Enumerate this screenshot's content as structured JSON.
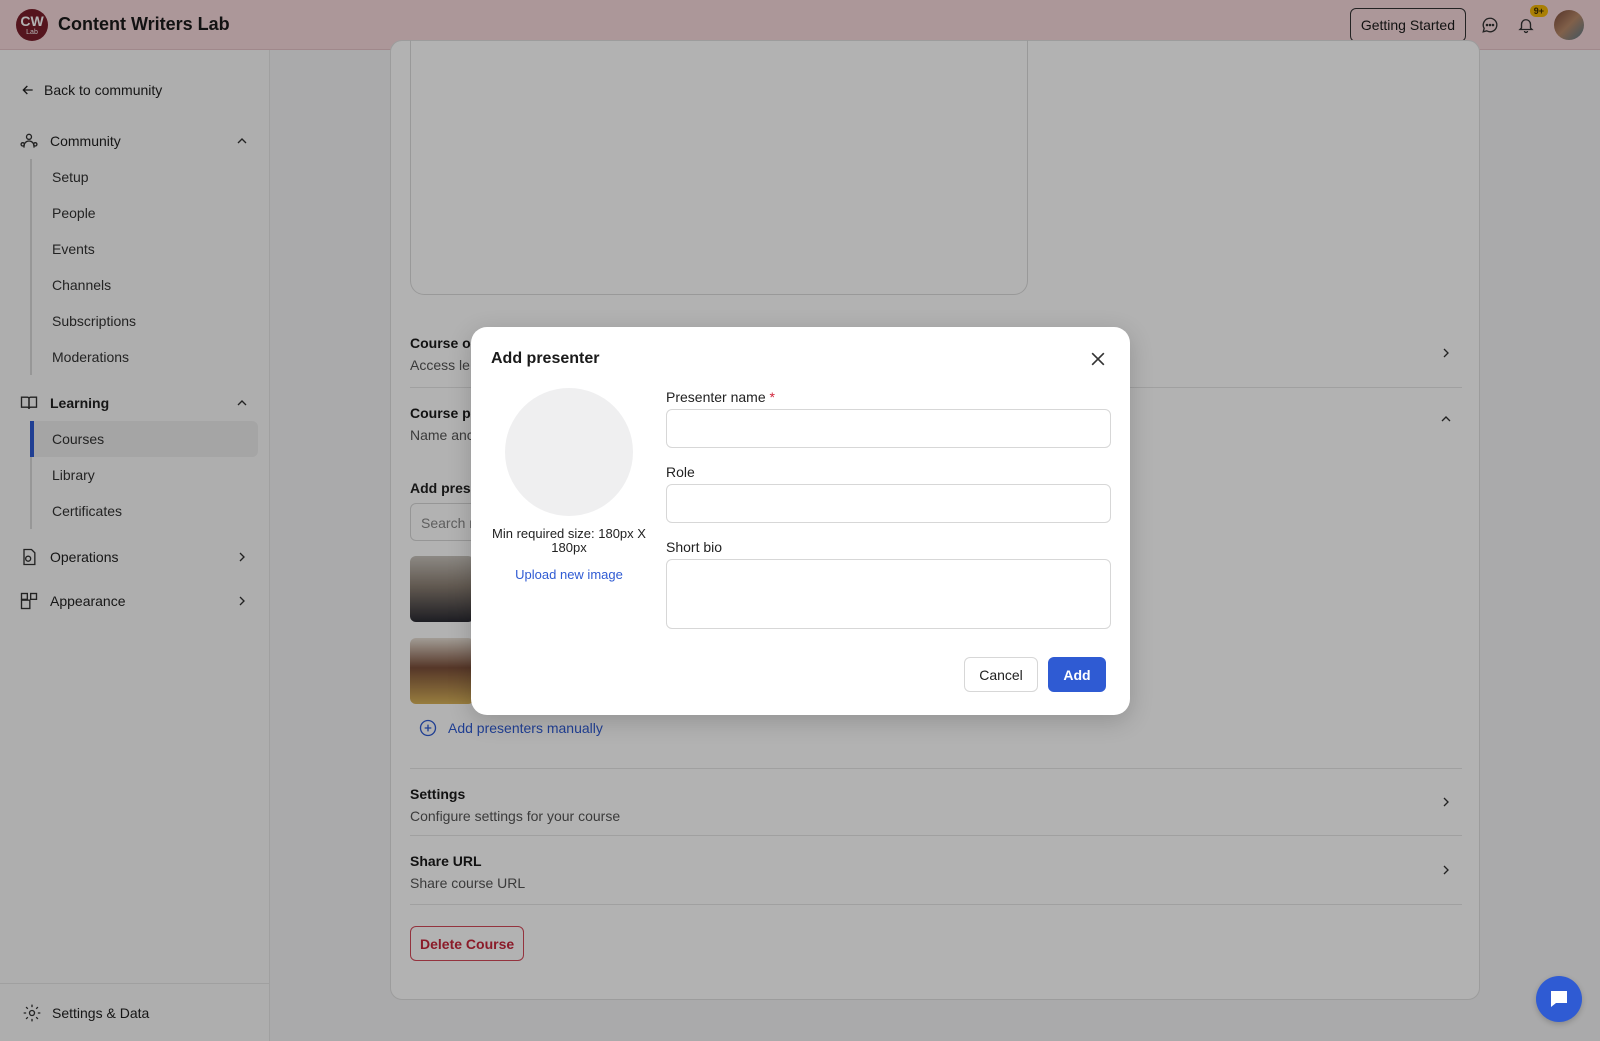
{
  "header": {
    "logo_big": "CW",
    "logo_small": "Lab",
    "title": "Content Writers Lab",
    "getting_started": "Getting Started",
    "notification_badge": "9+",
    "icons": [
      "chat-bubble-icon",
      "bell-icon"
    ]
  },
  "sidebar": {
    "back": "Back to community",
    "community": {
      "label": "Community",
      "items": [
        "Setup",
        "People",
        "Events",
        "Channels",
        "Subscriptions",
        "Moderations"
      ]
    },
    "learning": {
      "label": "Learning",
      "items": [
        "Courses",
        "Library",
        "Certificates"
      ],
      "active": "Courses"
    },
    "operations": "Operations",
    "appearance": "Appearance",
    "settings_data": "Settings & Data"
  },
  "main": {
    "course_options": {
      "title": "Course op",
      "subtitle": "Access le"
    },
    "course_presenters": {
      "title": "Course pr",
      "subtitle": "Name anc"
    },
    "add_presenters_label": "Add prese",
    "search_placeholder": "Search r",
    "add_manually": "Add presenters manually",
    "settings": {
      "title": "Settings",
      "subtitle": "Configure settings for your course"
    },
    "share_url": {
      "title": "Share URL",
      "subtitle": "Share course URL"
    },
    "delete_course": "Delete Course"
  },
  "modal": {
    "title": "Add presenter",
    "min_size": "Min required size: 180px X 180px",
    "upload": "Upload new image",
    "presenter_name_label": "Presenter name",
    "required_mark": "*",
    "presenter_name_value": "",
    "role_label": "Role",
    "role_value": "",
    "bio_label": "Short bio",
    "bio_value": "",
    "cancel": "Cancel",
    "add": "Add"
  },
  "colors": {
    "accent": "#2f5bd3",
    "header_bg": "#f7d9dc",
    "danger": "#c8283c"
  }
}
